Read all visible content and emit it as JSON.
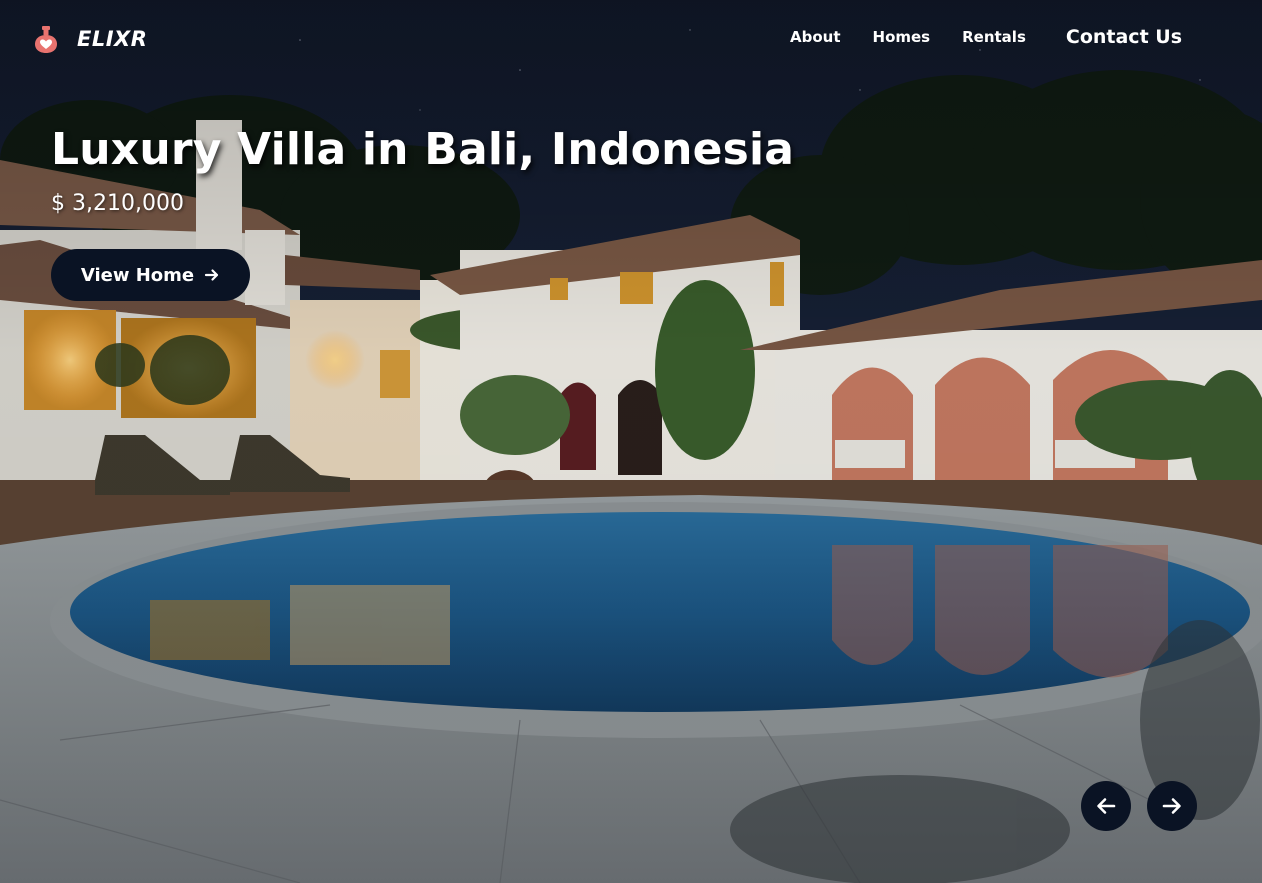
{
  "brand": {
    "name": "ELIXR",
    "logo_icon": "potion-heart-icon"
  },
  "nav": {
    "about": "About",
    "homes": "Homes",
    "rentals": "Rentals",
    "contact": "Contact Us"
  },
  "hero": {
    "title": "Luxury Villa in Bali, Indonesia",
    "price": "$ 3,210,000",
    "cta_label": "View Home",
    "cta_icon": "arrow-right-icon"
  },
  "slider": {
    "prev_icon": "arrow-left-icon",
    "next_icon": "arrow-right-icon"
  },
  "colors": {
    "button_bg": "#0a1324",
    "text": "#ffffff",
    "logo_accent": "#e8736f"
  }
}
